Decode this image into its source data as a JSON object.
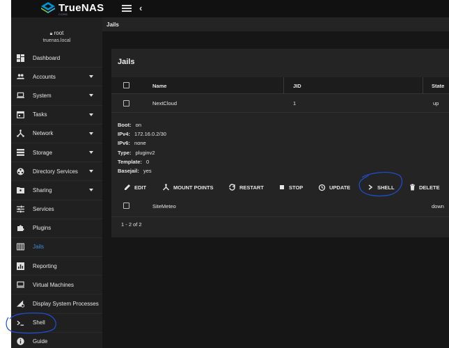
{
  "app": {
    "logo_text": "TrueNAS",
    "logo_sub": "CORE"
  },
  "user": {
    "name": "root",
    "host": "truenas.local"
  },
  "sidebar": {
    "items": [
      {
        "label": "Dashboard",
        "icon": "dashboard-icon",
        "caret": false
      },
      {
        "label": "Accounts",
        "icon": "people-icon",
        "caret": true
      },
      {
        "label": "System",
        "icon": "laptop-icon",
        "caret": true
      },
      {
        "label": "Tasks",
        "icon": "calendar-icon",
        "caret": true
      },
      {
        "label": "Network",
        "icon": "network-icon",
        "caret": true
      },
      {
        "label": "Storage",
        "icon": "storage-icon",
        "caret": true
      },
      {
        "label": "Directory Services",
        "icon": "directory-icon",
        "caret": true
      },
      {
        "label": "Sharing",
        "icon": "sharing-icon",
        "caret": true
      },
      {
        "label": "Services",
        "icon": "tune-icon",
        "caret": false
      },
      {
        "label": "Plugins",
        "icon": "puzzle-icon",
        "caret": false
      },
      {
        "label": "Jails",
        "icon": "jail-icon",
        "caret": false,
        "active": true
      },
      {
        "label": "Reporting",
        "icon": "chart-icon",
        "caret": false
      },
      {
        "label": "Virtual Machines",
        "icon": "computer-icon",
        "caret": false
      },
      {
        "label": "Display System Processes",
        "icon": "processes-icon",
        "caret": false
      },
      {
        "label": "Shell",
        "icon": "terminal-icon",
        "caret": false
      },
      {
        "label": "Guide",
        "icon": "info-icon",
        "caret": false
      }
    ]
  },
  "page": {
    "breadcrumb": "Jails",
    "card_title": "Jails"
  },
  "table": {
    "columns": [
      "Name",
      "JID",
      "State"
    ],
    "rows": [
      {
        "name": "NextCloud",
        "jid": "1",
        "state": "up"
      },
      {
        "name": "SiteMeteo",
        "jid": "",
        "state": "down"
      }
    ]
  },
  "details": {
    "boot_label": "Boot:",
    "boot": "on",
    "ipv4_label": "IPv4:",
    "ipv4": "172.16.0.2/30",
    "ipv6_label": "IPv6:",
    "ipv6": "none",
    "type_label": "Type:",
    "type": "pluginv2",
    "template_label": "Template:",
    "template": "0",
    "basejail_label": "Basejail:",
    "basejail": "yes"
  },
  "actions": {
    "edit": "EDIT",
    "mount_points": "MOUNT POINTS",
    "restart": "RESTART",
    "stop": "STOP",
    "update": "UPDATE",
    "shell": "SHELL",
    "delete": "DELETE"
  },
  "footer": {
    "pagination": "1 - 2 of 2"
  },
  "colors": {
    "accent": "#3b8ed8",
    "annotation": "#1f4fd8"
  }
}
